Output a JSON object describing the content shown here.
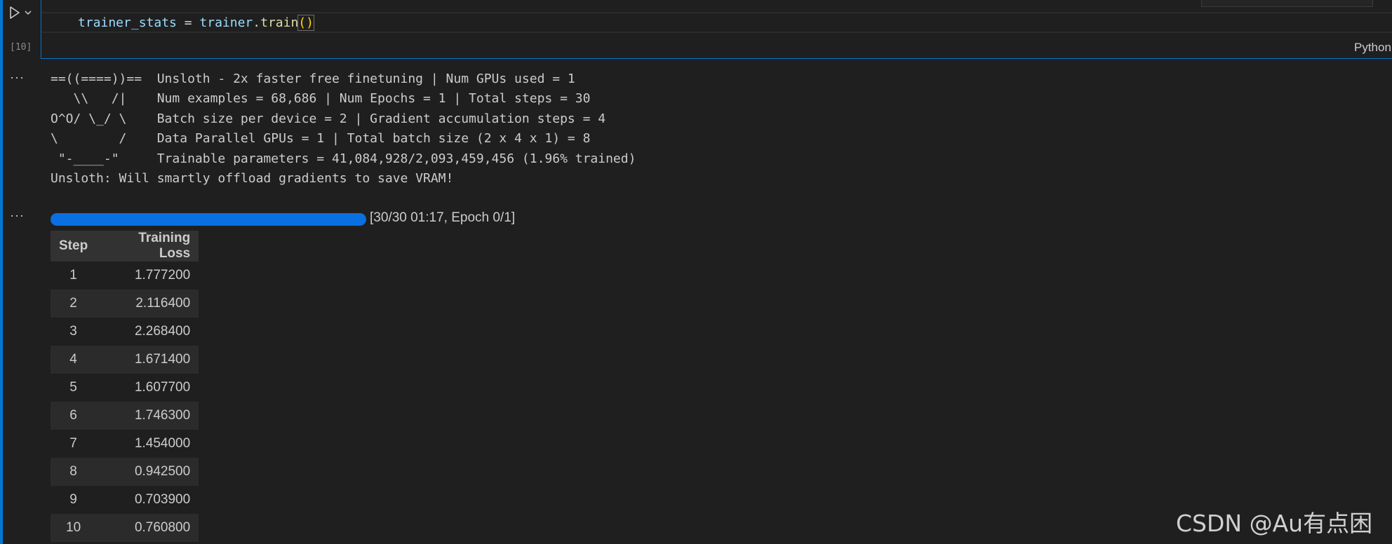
{
  "cell": {
    "execution_count": "[10]",
    "code_tokens": [
      "trainer_stats",
      " = ",
      "trainer",
      ".",
      "train",
      "()"
    ],
    "language": "Python"
  },
  "output_menu_glyph": "···",
  "stream_output": {
    "lines": [
      "==((====))==  Unsloth - 2x faster free finetuning | Num GPUs used = 1",
      "   \\\\   /|    Num examples = 68,686 | Num Epochs = 1 | Total steps = 30",
      "O^O/ \\_/ \\    Batch size per device = 2 | Gradient accumulation steps = 4",
      "\\        /    Data Parallel GPUs = 1 | Total batch size (2 x 4 x 1) = 8",
      " \"-____-\"     Trainable parameters = 41,084,928/2,093,459,456 (1.96% trained)",
      "Unsloth: Will smartly offload gradients to save VRAM!"
    ]
  },
  "progress": {
    "fraction": 1.0,
    "text": "[30/30 01:17, Epoch 0/1]",
    "color": "#0a6fe0"
  },
  "table": {
    "headers": [
      "Step",
      "Training Loss"
    ],
    "rows": [
      [
        "1",
        "1.777200"
      ],
      [
        "2",
        "2.116400"
      ],
      [
        "3",
        "2.268400"
      ],
      [
        "4",
        "1.671400"
      ],
      [
        "5",
        "1.607700"
      ],
      [
        "6",
        "1.746300"
      ],
      [
        "7",
        "1.454000"
      ],
      [
        "8",
        "0.942500"
      ],
      [
        "9",
        "0.703900"
      ],
      [
        "10",
        "0.760800"
      ]
    ]
  },
  "watermark": "CSDN @Au有点困",
  "colors": {
    "accent": "#0078d4",
    "background": "#1f1f1f"
  },
  "icons": {
    "run": "play-icon",
    "run_options": "chevron-down-icon"
  }
}
